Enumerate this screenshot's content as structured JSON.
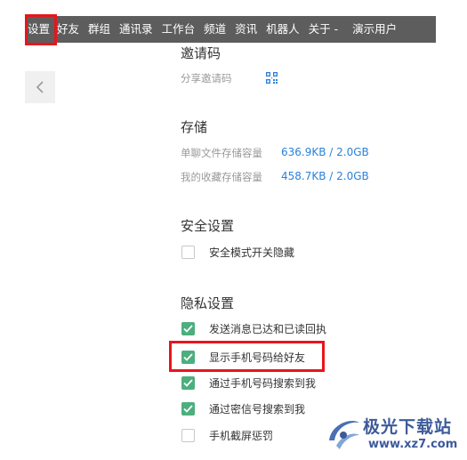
{
  "topbar": {
    "tabs": [
      "设置",
      "好友",
      "群组",
      "通讯录",
      "工作台",
      "频道",
      "资讯",
      "机器人",
      "关于 -"
    ],
    "user": "演示用户"
  },
  "invite": {
    "title": "邀请码",
    "share_label": "分享邀请码",
    "icon": "qr-code-icon"
  },
  "storage": {
    "title": "存储",
    "rows": [
      {
        "label": "单聊文件存储容量",
        "value": "636.9KB / 2.0GB"
      },
      {
        "label": "我的收藏存储容量",
        "value": "458.7KB / 2.0GB"
      }
    ]
  },
  "security": {
    "title": "安全设置",
    "options": [
      {
        "label": "安全模式开关隐藏",
        "checked": false
      }
    ]
  },
  "privacy": {
    "title": "隐私设置",
    "options": [
      {
        "label": "发送消息已达和已读回执",
        "checked": true
      },
      {
        "label": "显示手机号码给好友",
        "checked": true
      },
      {
        "label": "通过手机号码搜索到我",
        "checked": true
      },
      {
        "label": "通过密信号搜索到我",
        "checked": true
      },
      {
        "label": "手机截屏惩罚",
        "checked": false
      }
    ]
  },
  "watermark": {
    "top": "极光下载站",
    "bottom": "www.xz7.com"
  },
  "colors": {
    "highlight": "#e8151b",
    "check": "#4caf7d",
    "link": "#2a82d8",
    "topbar": "#5d5d5d"
  }
}
